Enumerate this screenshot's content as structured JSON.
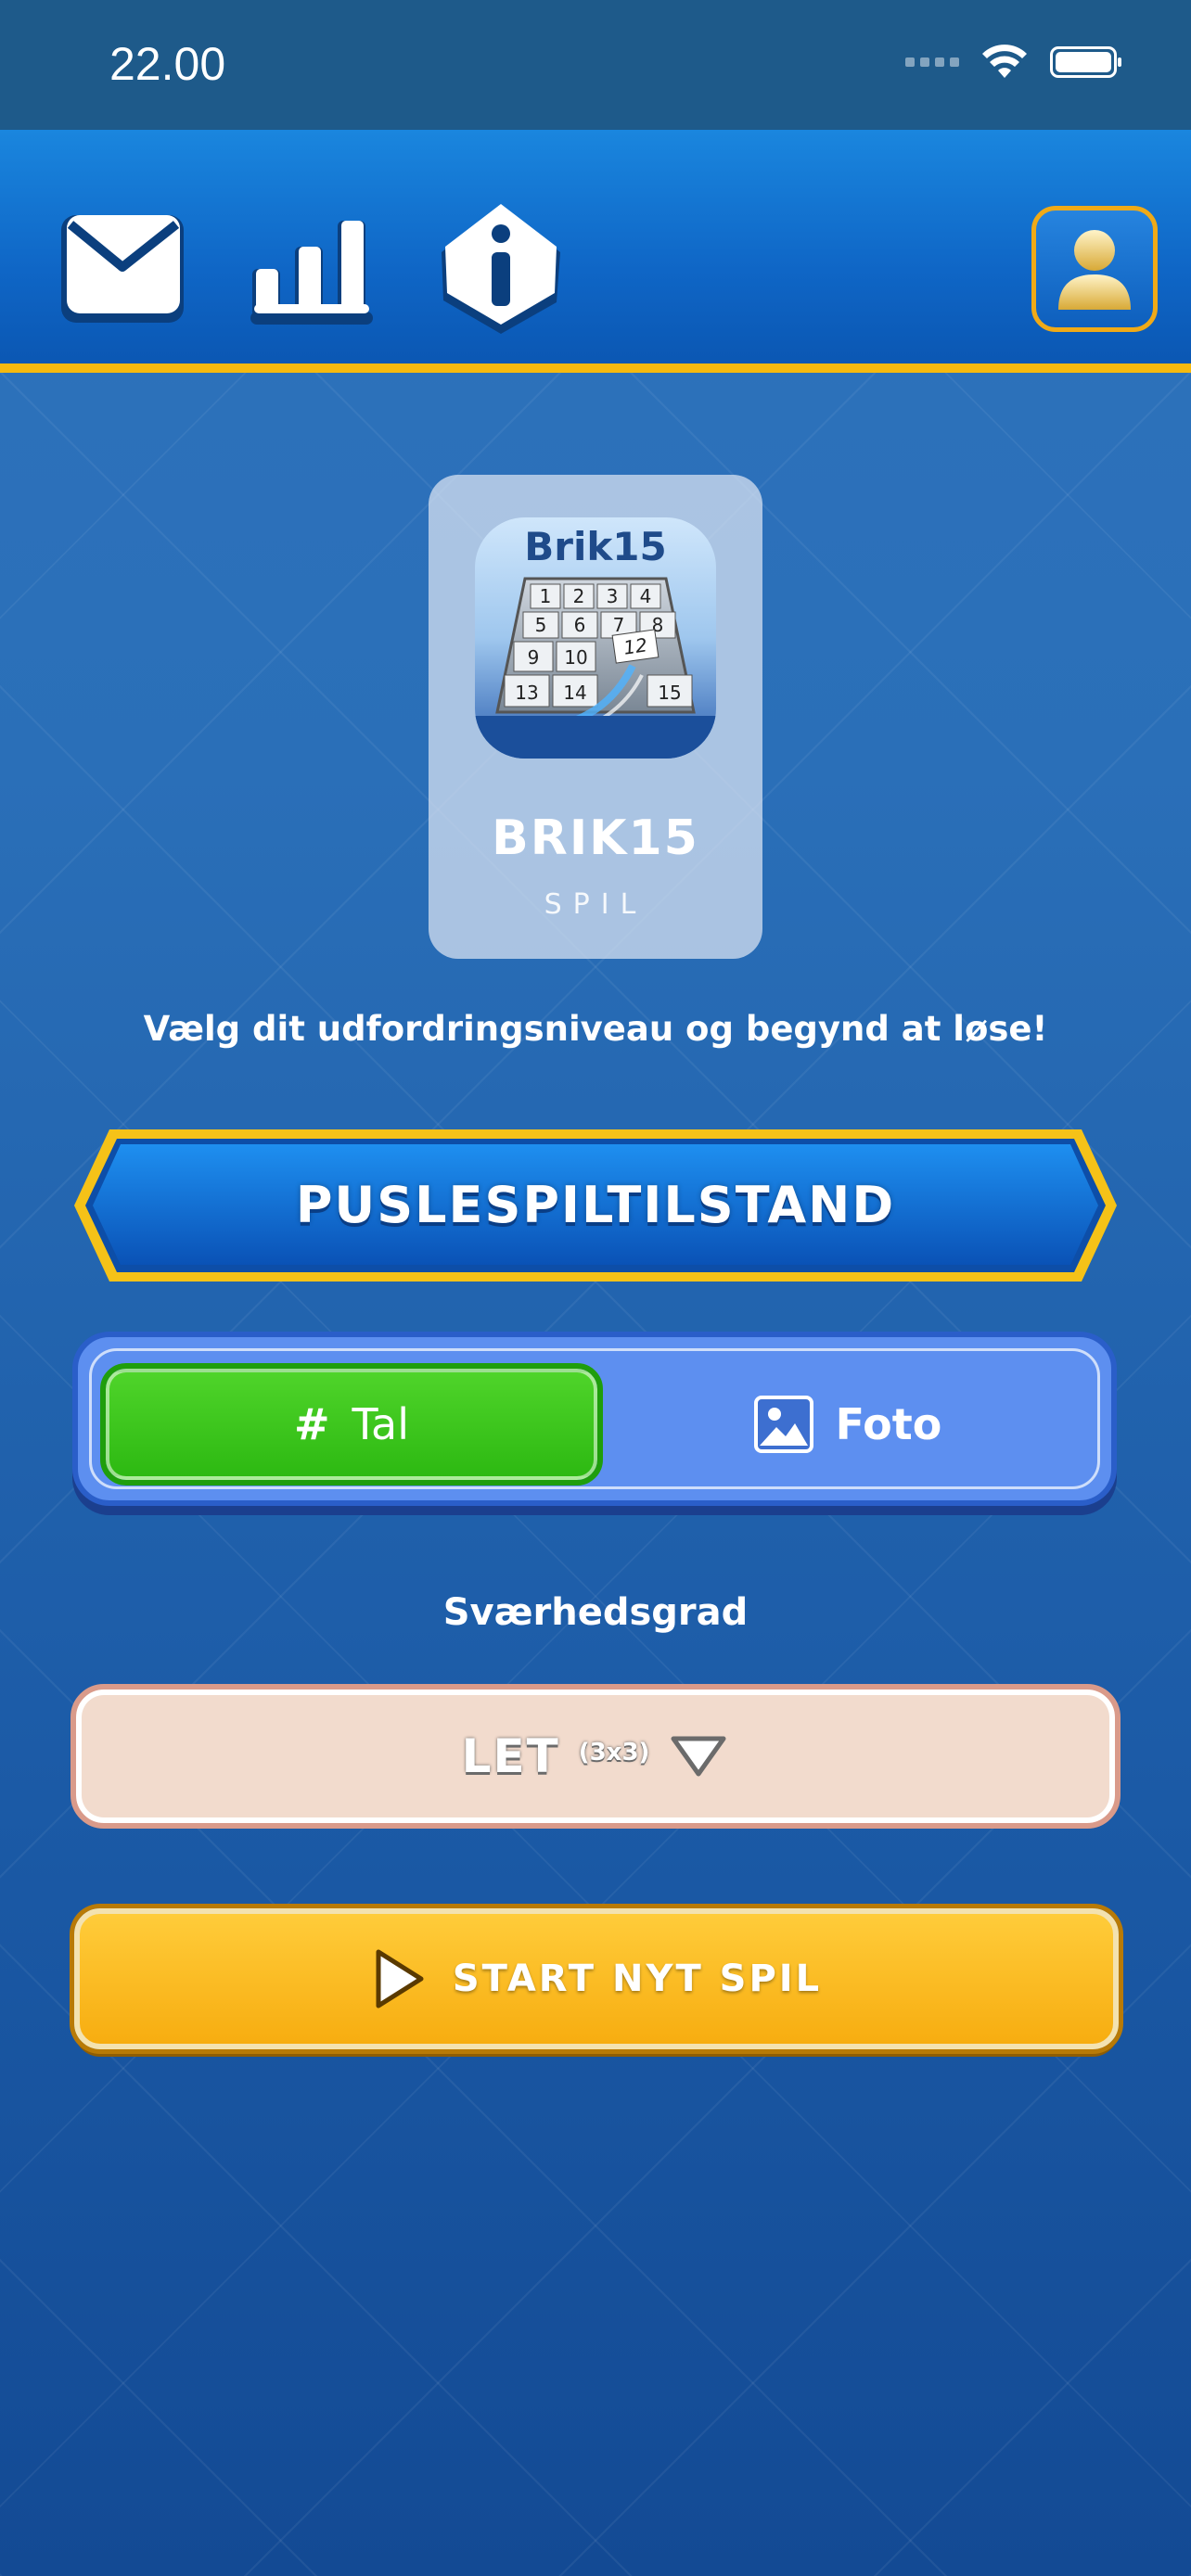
{
  "status_bar": {
    "time": "22.00"
  },
  "toolbar": {
    "icons": [
      "mail-icon",
      "stats-icon",
      "info-icon",
      "profile-icon"
    ]
  },
  "game_card": {
    "icon_title": "Brik15",
    "tiles": [
      "1",
      "2",
      "3",
      "4",
      "5",
      "6",
      "7",
      "8",
      "9",
      "10",
      "12",
      "13",
      "14",
      "15"
    ],
    "title": "BRIK15",
    "subtitle": "SPIL"
  },
  "main": {
    "subtitle": "Vælg dit udfordringsniveau og begynd at løse!",
    "mode_banner": "PUSLESPILTILSTAND",
    "toggle": {
      "tal_symbol": "#",
      "tal_label": "Tal",
      "foto_label": "Foto",
      "selected": "Tal"
    },
    "difficulty_label": "Sværhedsgrad",
    "difficulty_value": "LET",
    "difficulty_size": "(3x3)",
    "start_button": "START NYT SPIL"
  },
  "colors": {
    "accent_yellow": "#f5b90f",
    "toggle_green": "#2db912",
    "toolbar_blue": "#0f66c6"
  }
}
